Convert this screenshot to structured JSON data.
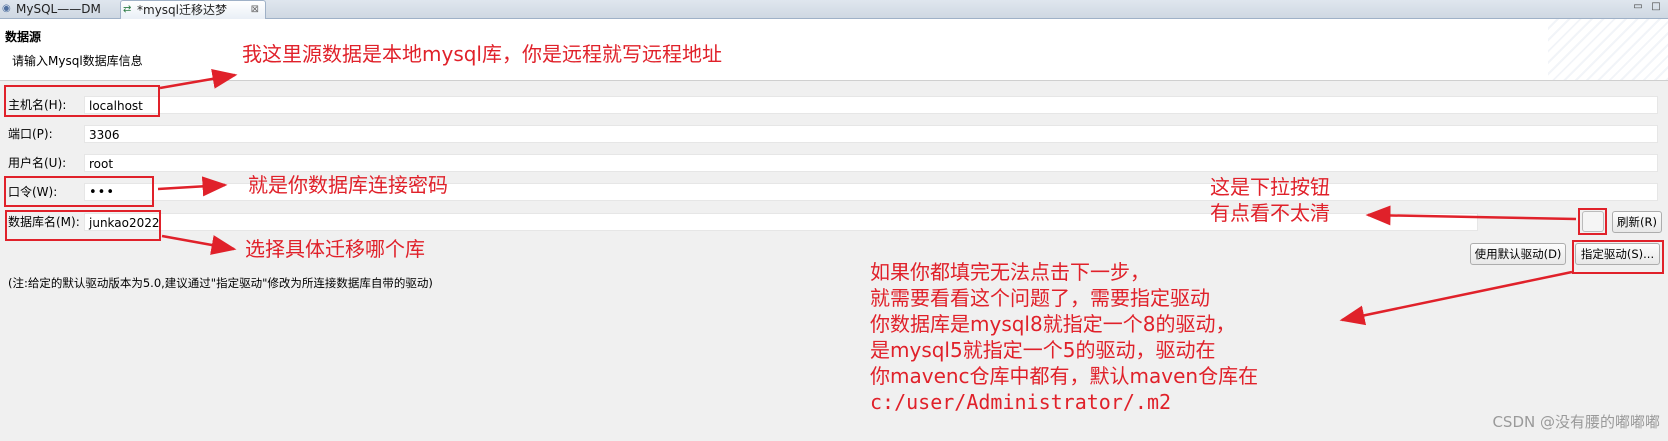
{
  "tabs": [
    {
      "label": "MySQL——DM",
      "icon": "database-icon"
    },
    {
      "label": "*mysql迁移达梦",
      "icon": "migration-icon",
      "close": "⊠"
    }
  ],
  "window_controls": {
    "minimize": "▭",
    "maximize": "□"
  },
  "header": {
    "title": "数据源",
    "description": "请输入Mysql数据库信息"
  },
  "form": {
    "host": {
      "label": "主机名(H):",
      "value": "localhost"
    },
    "port": {
      "label": "端口(P):",
      "value": "3306"
    },
    "user": {
      "label": "用户名(U):",
      "value": "root"
    },
    "password": {
      "label": "口令(W):",
      "value": "•••"
    },
    "database": {
      "label": "数据库名(M):",
      "value": "junkao2022"
    }
  },
  "buttons": {
    "refresh": "刷新(R)",
    "default_driver": "使用默认驱动(D)",
    "specify_driver": "指定驱动(S)..."
  },
  "note": "(注:给定的默认驱动版本为5.0,建议通过\"指定驱动\"修改为所连接数据库自带的驱动)",
  "annotations": {
    "host": "我这里源数据是本地mysql库，你是远程就写远程地址",
    "password": "就是你数据库连接密码",
    "database": "选择具体迁移哪个库",
    "dropdown_line1": "这是下拉按钮",
    "dropdown_line2": "有点看不太清",
    "driver_lines": [
      "如果你都填完无法点击下一步，",
      "就需要看看这个问题了，需要指定驱动",
      "你数据库是mysql8就指定一个8的驱动，",
      "是mysql5就指定一个5的驱动，驱动在",
      "你mavenc仓库中都有，默认maven仓库在",
      "c:/user/Administrator/.m2"
    ]
  },
  "watermark": "CSDN @没有腰的嘟嘟嘟",
  "colors": {
    "annotation": "#e0212a",
    "header_bg": "#ffffff",
    "body_bg": "#f0f0f0"
  }
}
